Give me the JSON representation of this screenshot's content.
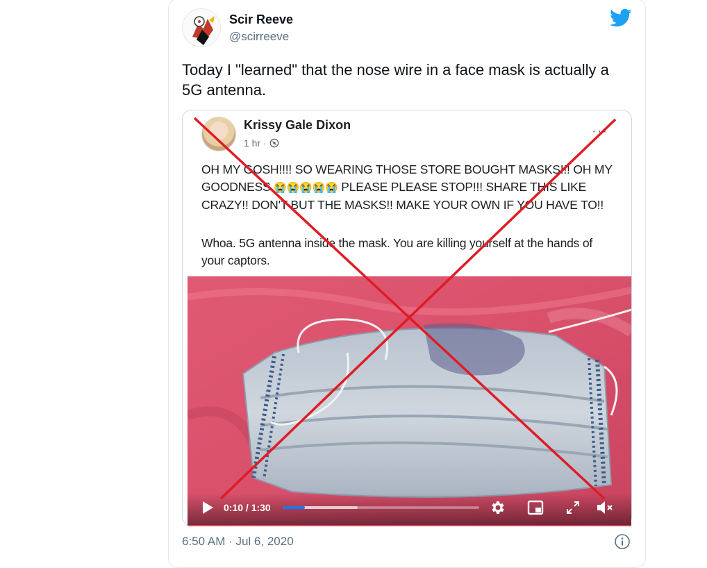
{
  "tweet": {
    "author_name": "Scir Reeve",
    "author_handle": "@scirreeve",
    "text": "Today I \"learned\" that the nose wire in a face mask is actually a 5G antenna.",
    "timestamp": "6:50 AM · Jul 6, 2020",
    "brand_icon": "twitter-bird-icon",
    "brand_color": "#1da1f2"
  },
  "embedded_post": {
    "author_name": "Krissy Gale Dixon",
    "time": "1 hr ·",
    "privacy_icon": "globe-icon",
    "more": "···",
    "text_before_emoji": "OH MY GOSH!!!! SO WEARING THOSE STORE BOUGHT MASKS!!! OH MY GOODNESS ",
    "emoji": "😭😭😭😭😭",
    "text_after_emoji": " PLEASE PLEASE STOP!!! SHARE THIS LIKE CRAZY!! DON'T BUT THE MASKS!! MAKE YOUR OWN IF YOU HAVE TO!!",
    "sub_text": "Whoa. 5G antenna inside the mask. You are killing yourself at the hands of your captors."
  },
  "video": {
    "time_display": "0:10 / 1:30",
    "progress": 0.111,
    "buffered": 0.38,
    "progress_color": "#1877f2",
    "controls": [
      "play-icon",
      "gear-icon",
      "pip-icon",
      "expand-icon",
      "volume-icon"
    ]
  },
  "overlay": {
    "cross_color": "#e01b24"
  }
}
